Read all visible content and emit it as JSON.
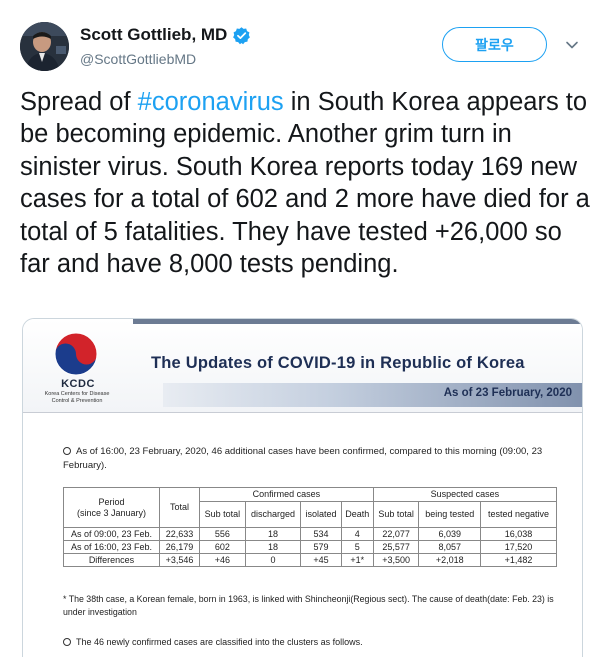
{
  "author": {
    "name": "Scott Gottlieb, MD",
    "handle": "@ScottGottliebMD",
    "follow_label": "팔로우"
  },
  "tweet": {
    "text_before": "Spread of ",
    "hashtag": "#coronavirus",
    "text_after": " in South Korea appears to be becoming epidemic. Another grim turn in sinister virus. South Korea reports today 169 new cases for a total of 602 and 2 more have died for a total of 5 fatalities. They have tested +26,000 so far and have 8,000 tests pending."
  },
  "media": {
    "org_acronym": "KCDC",
    "org_name_line1": "Korea Centers for Disease",
    "org_name_line2": "Control & Prevention",
    "title": "The Updates of COVID-19 in Republic of Korea",
    "as_of": "As of  23 February, 2020",
    "paragraph1": "As of 16:00, 23 February, 2020, 46 additional cases have been confirmed, compared to this morning (09:00, 23 February).",
    "table": {
      "period_label": "Period",
      "period_sub": "(since 3 January)",
      "total_label": "Total",
      "confirmed_group": "Confirmed cases",
      "suspected_group": "Suspected cases",
      "confirmed_cols": [
        "Sub total",
        "discharged",
        "isolated",
        "Death"
      ],
      "suspected_cols": [
        "Sub total",
        "being tested",
        "tested negative"
      ],
      "rows": [
        [
          "As of 09:00, 23 Feb.",
          "22,633",
          "556",
          "18",
          "534",
          "4",
          "22,077",
          "6,039",
          "16,038"
        ],
        [
          "As of 16:00, 23 Feb.",
          "26,179",
          "602",
          "18",
          "579",
          "5",
          "25,577",
          "8,057",
          "17,520"
        ],
        [
          "Differences",
          "+3,546",
          "+46",
          "0",
          "+45",
          "+1*",
          "+3,500",
          "+2,018",
          "+1,482"
        ]
      ]
    },
    "footnote": "* The 38th case, a Korean female, born in 1963, is linked with Shincheonji(Regious sect). The cause of death(date: Feb. 23) is under investigation",
    "paragraph2": "The 46 newly confirmed cases are classified into the clusters as follows."
  }
}
